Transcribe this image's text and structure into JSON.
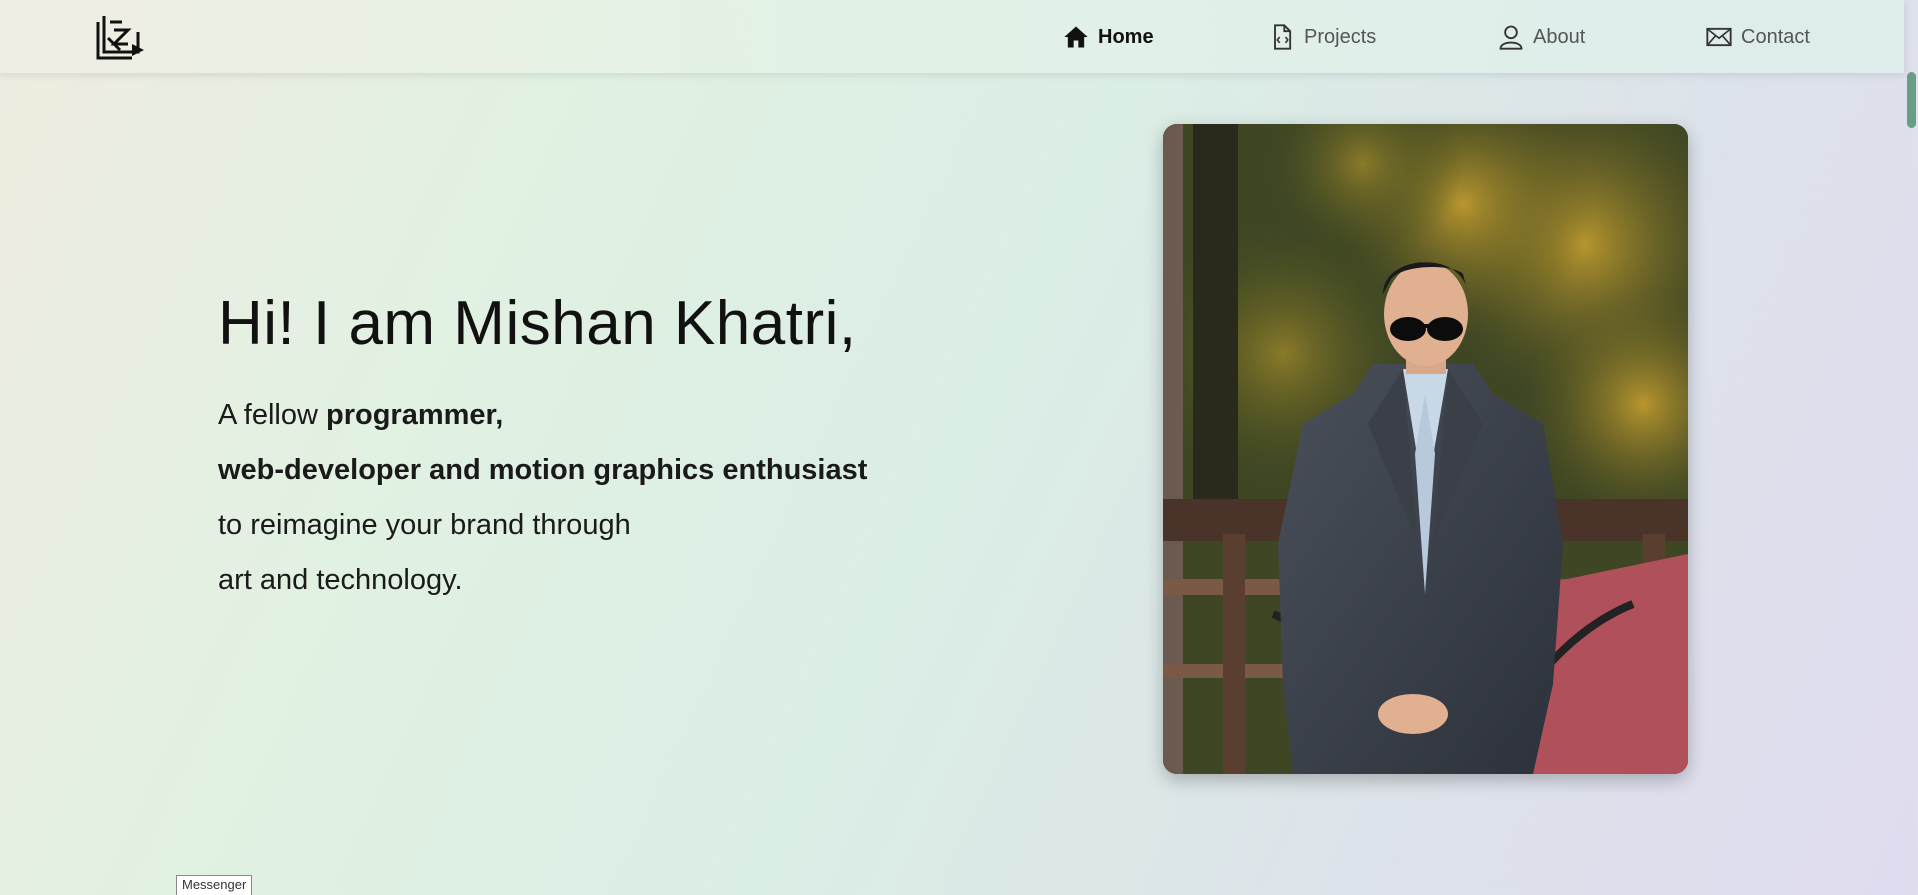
{
  "nav": {
    "items": [
      {
        "label": "Home",
        "icon": "home-icon",
        "active": true
      },
      {
        "label": "Projects",
        "icon": "code-file-icon",
        "active": false
      },
      {
        "label": "About",
        "icon": "person-icon",
        "active": false
      },
      {
        "label": "Contact",
        "icon": "envelope-icon",
        "active": false
      }
    ]
  },
  "hero": {
    "heading": "Hi! I am Mishan Khatri,",
    "line1_prefix": "A fellow ",
    "line1_bold": "programmer,",
    "line2_bold": "web-developer and motion graphics enthusiast",
    "line3": "to reimagine your brand through",
    "line4": "art and technology."
  },
  "messenger": {
    "label": "Messenger"
  },
  "colors": {
    "accent": "#4a8f6a",
    "text": "#111111",
    "muted": "#555555"
  }
}
